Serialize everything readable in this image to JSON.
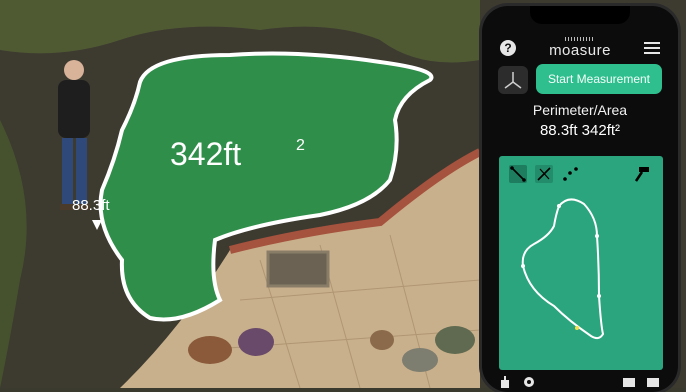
{
  "scene": {
    "area_label": "342ft",
    "area_superscript": "2",
    "perimeter_label": "88.3ft"
  },
  "app": {
    "logo_text": "moasure",
    "start_button_label": "Start Measurement",
    "result_title": "Perimeter/Area",
    "result_value": "88.3ft 342ft²",
    "accent_color": "#2fbf8f",
    "panel_color": "#2aa57e"
  },
  "icons": [
    "help-icon",
    "menu-icon",
    "axis-icon",
    "line-tool-icon",
    "angle-tool-icon",
    "point-tool-icon",
    "hammer-icon",
    "export-icon",
    "settings-icon",
    "folder-icon"
  ]
}
